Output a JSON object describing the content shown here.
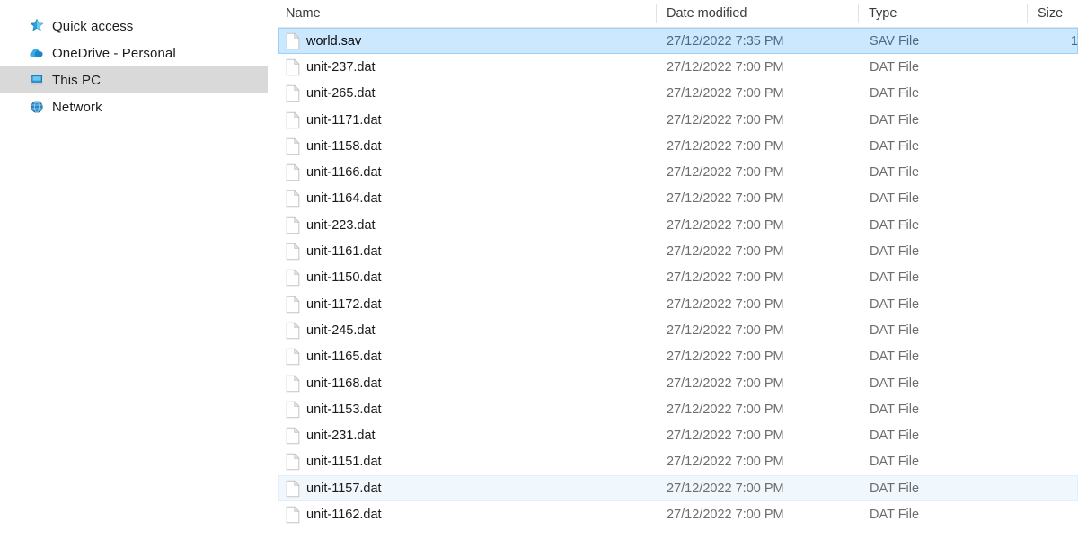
{
  "sidebar": {
    "items": [
      {
        "label": "Quick access",
        "icon": "star-icon",
        "selected": false
      },
      {
        "label": "OneDrive - Personal",
        "icon": "cloud-icon",
        "selected": false
      },
      {
        "label": "This PC",
        "icon": "monitor-icon",
        "selected": true
      },
      {
        "label": "Network",
        "icon": "network-icon",
        "selected": false
      }
    ]
  },
  "file_list": {
    "columns": [
      {
        "key": "name",
        "label": "Name"
      },
      {
        "key": "date",
        "label": "Date modified"
      },
      {
        "key": "type",
        "label": "Type"
      },
      {
        "key": "size",
        "label": "Size"
      }
    ],
    "rows": [
      {
        "name": "world.sav",
        "date": "27/12/2022 7:35 PM",
        "type": "SAV File",
        "size": "1",
        "state": "selected"
      },
      {
        "name": "unit-237.dat",
        "date": "27/12/2022 7:00 PM",
        "type": "DAT File",
        "size": "",
        "state": ""
      },
      {
        "name": "unit-265.dat",
        "date": "27/12/2022 7:00 PM",
        "type": "DAT File",
        "size": "",
        "state": ""
      },
      {
        "name": "unit-1171.dat",
        "date": "27/12/2022 7:00 PM",
        "type": "DAT File",
        "size": "",
        "state": ""
      },
      {
        "name": "unit-1158.dat",
        "date": "27/12/2022 7:00 PM",
        "type": "DAT File",
        "size": "",
        "state": ""
      },
      {
        "name": "unit-1166.dat",
        "date": "27/12/2022 7:00 PM",
        "type": "DAT File",
        "size": "",
        "state": ""
      },
      {
        "name": "unit-1164.dat",
        "date": "27/12/2022 7:00 PM",
        "type": "DAT File",
        "size": "",
        "state": ""
      },
      {
        "name": "unit-223.dat",
        "date": "27/12/2022 7:00 PM",
        "type": "DAT File",
        "size": "",
        "state": ""
      },
      {
        "name": "unit-1161.dat",
        "date": "27/12/2022 7:00 PM",
        "type": "DAT File",
        "size": "",
        "state": ""
      },
      {
        "name": "unit-1150.dat",
        "date": "27/12/2022 7:00 PM",
        "type": "DAT File",
        "size": "",
        "state": ""
      },
      {
        "name": "unit-1172.dat",
        "date": "27/12/2022 7:00 PM",
        "type": "DAT File",
        "size": "",
        "state": ""
      },
      {
        "name": "unit-245.dat",
        "date": "27/12/2022 7:00 PM",
        "type": "DAT File",
        "size": "",
        "state": ""
      },
      {
        "name": "unit-1165.dat",
        "date": "27/12/2022 7:00 PM",
        "type": "DAT File",
        "size": "",
        "state": ""
      },
      {
        "name": "unit-1168.dat",
        "date": "27/12/2022 7:00 PM",
        "type": "DAT File",
        "size": "",
        "state": ""
      },
      {
        "name": "unit-1153.dat",
        "date": "27/12/2022 7:00 PM",
        "type": "DAT File",
        "size": "",
        "state": ""
      },
      {
        "name": "unit-231.dat",
        "date": "27/12/2022 7:00 PM",
        "type": "DAT File",
        "size": "",
        "state": ""
      },
      {
        "name": "unit-1151.dat",
        "date": "27/12/2022 7:00 PM",
        "type": "DAT File",
        "size": "",
        "state": ""
      },
      {
        "name": "unit-1157.dat",
        "date": "27/12/2022 7:00 PM",
        "type": "DAT File",
        "size": "",
        "state": "hover"
      },
      {
        "name": "unit-1162.dat",
        "date": "27/12/2022 7:00 PM",
        "type": "DAT File",
        "size": "",
        "state": ""
      }
    ]
  },
  "colors": {
    "selection": "#cce8ff",
    "hover": "#f0f7fd",
    "sidebar_selection": "#d9d9d9",
    "accent_icon_blue": "#1a9bd7"
  }
}
